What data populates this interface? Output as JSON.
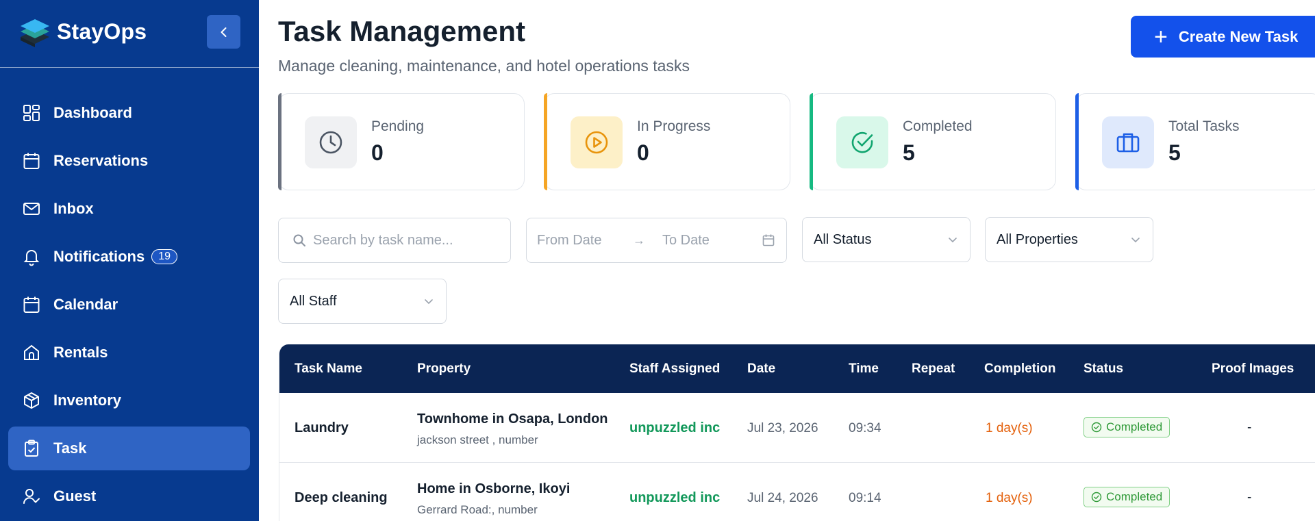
{
  "brand": {
    "name": "StayOps"
  },
  "sidebar": {
    "items": [
      {
        "label": "Dashboard",
        "icon": "dashboard-icon"
      },
      {
        "label": "Reservations",
        "icon": "calendar-icon"
      },
      {
        "label": "Inbox",
        "icon": "mail-icon"
      },
      {
        "label": "Notifications",
        "icon": "bell-icon",
        "badge": "19"
      },
      {
        "label": "Calendar",
        "icon": "calendar-icon"
      },
      {
        "label": "Rentals",
        "icon": "home-icon"
      },
      {
        "label": "Inventory",
        "icon": "box-icon"
      },
      {
        "label": "Task",
        "icon": "clipboard-check-icon",
        "active": true
      },
      {
        "label": "Guest",
        "icon": "user-check-icon"
      }
    ]
  },
  "header": {
    "title": "Task Management",
    "subtitle": "Manage cleaning, maintenance, and hotel operations tasks",
    "create_label": "Create New Task"
  },
  "stats": [
    {
      "label": "Pending",
      "value": "0",
      "accent": "#6b7280",
      "icon_bg": "#f0f1f3",
      "icon": "clock-icon"
    },
    {
      "label": "In Progress",
      "value": "0",
      "accent": "#f5a524",
      "icon_bg": "#fdf0c8",
      "icon": "play-circle-icon"
    },
    {
      "label": "Completed",
      "value": "5",
      "accent": "#16b981",
      "icon_bg": "#d9f8ea",
      "icon": "check-circle-icon"
    },
    {
      "label": "Total Tasks",
      "value": "5",
      "accent": "#1d5fe6",
      "icon_bg": "#dfe9fc",
      "icon": "briefcase-icon"
    }
  ],
  "filters": {
    "search_placeholder": "Search by task name...",
    "from_date_placeholder": "From Date",
    "to_date_placeholder": "To Date",
    "status": "All Status",
    "properties": "All Properties",
    "staff": "All Staff"
  },
  "table": {
    "columns": [
      "Task Name",
      "Property",
      "Staff Assigned",
      "Date",
      "Time",
      "Repeat",
      "Completion",
      "Status",
      "Proof Images"
    ],
    "rows": [
      {
        "task": "Laundry",
        "property": "Townhome in Osapa, London",
        "address": "jackson street , number",
        "staff": "unpuzzled inc",
        "date": "Jul 23, 2026",
        "time": "09:34",
        "repeat": "",
        "completion": "1 day(s)",
        "status": "Completed",
        "proof": "-"
      },
      {
        "task": "Deep cleaning",
        "property": "Home in Osborne, Ikoyi",
        "address": "Gerrard Road:, number",
        "staff": "unpuzzled inc",
        "date": "Jul 24, 2026",
        "time": "09:14",
        "repeat": "",
        "completion": "1 day(s)",
        "status": "Completed",
        "proof": "-"
      }
    ]
  }
}
